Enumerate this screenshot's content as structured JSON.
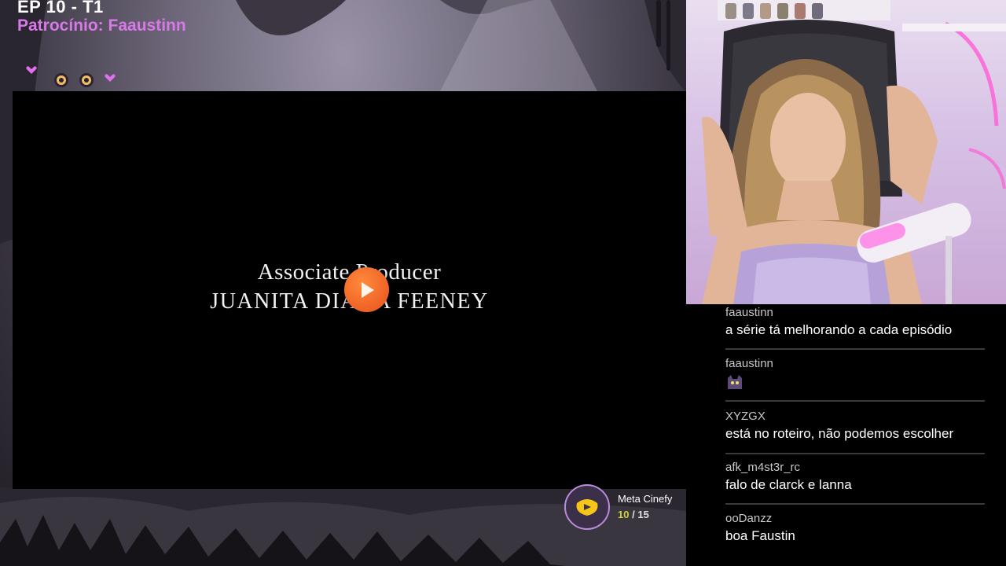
{
  "overlay": {
    "episode": "EP 10 - T1",
    "sponsor": "Patrocínio: Faaustinn"
  },
  "video": {
    "credit_role": "Associate Producer",
    "credit_name": "JUANITA DIANA FEENEY",
    "play_icon": "play-icon"
  },
  "meta_widget": {
    "label": "Meta Cinefy",
    "current": "10",
    "separator": "/",
    "total": "15",
    "progress": 0.667,
    "icon": "cinefy-logo-icon"
  },
  "chat": {
    "messages": [
      {
        "user": "faaustinn",
        "text": "a série tá melhorando a cada episódio"
      },
      {
        "user": "faaustinn",
        "text": "",
        "emote": "cat-emote-icon"
      },
      {
        "user": "XYZGX",
        "text": "está no roteiro, não podemos escolher"
      },
      {
        "user": "afk_m4st3r_rc",
        "text": "falo de clarck e lanna"
      },
      {
        "user": "ooDanzz",
        "text": "boa Faustin"
      }
    ]
  },
  "colors": {
    "sponsor": "#d978e8",
    "play_button": "#e8501a",
    "meta_current": "#d0d040",
    "chat_bg": "#000000"
  }
}
